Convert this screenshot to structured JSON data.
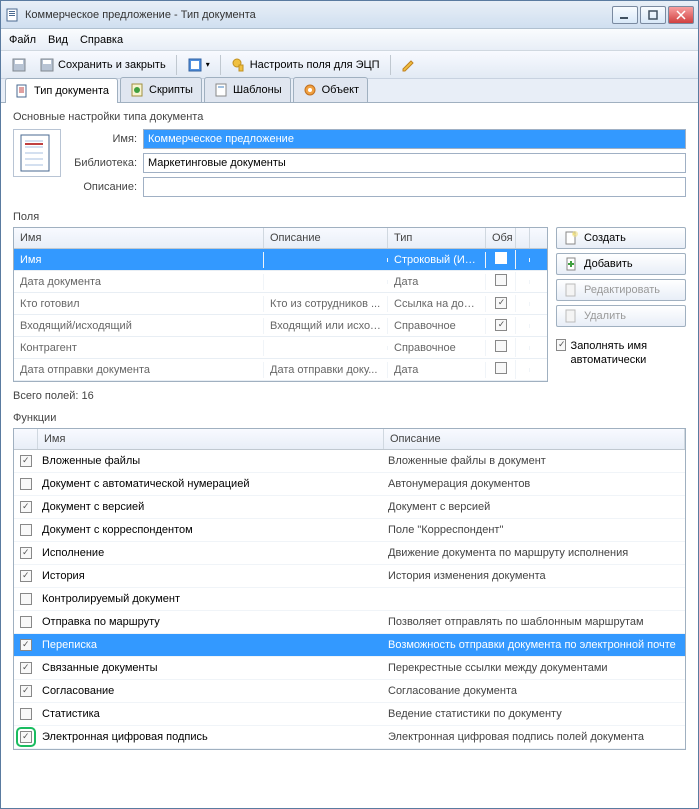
{
  "window": {
    "title": "Коммерческое предложение - Тип документа"
  },
  "menu": {
    "file": "Файл",
    "view": "Вид",
    "help": "Справка"
  },
  "toolbar": {
    "save_close": "Сохранить и закрыть",
    "configure_eds": "Настроить поля для ЭЦП"
  },
  "tabs": [
    {
      "label": "Тип документа"
    },
    {
      "label": "Скрипты"
    },
    {
      "label": "Шаблоны"
    },
    {
      "label": "Объект"
    }
  ],
  "section": "Основные настройки типа документа",
  "form": {
    "name_label": "Имя:",
    "name_value": "Коммерческое предложение",
    "library_label": "Библиотека:",
    "library_value": "Маркетинговые документы",
    "desc_label": "Описание:",
    "desc_value": ""
  },
  "fields_label": "Поля",
  "fields_head": {
    "name": "Имя",
    "desc": "Описание",
    "type": "Тип",
    "req": "Обя"
  },
  "fields": [
    {
      "name": "Имя",
      "desc": "",
      "type": "Строковый (Инд...",
      "req": false,
      "selected": true
    },
    {
      "name": "Дата документа",
      "desc": "",
      "type": "Дата",
      "req": false
    },
    {
      "name": "Кто готовил",
      "desc": "Кто из сотрудников ...",
      "type": "Ссылка на доку...",
      "req": true
    },
    {
      "name": "Входящий/исходящий",
      "desc": "Входящий или исход...",
      "type": "Справочное",
      "req": true
    },
    {
      "name": "Контрагент",
      "desc": "",
      "type": "Справочное",
      "req": false
    },
    {
      "name": "Дата отправки документа",
      "desc": "Дата отправки доку...",
      "type": "Дата",
      "req": false
    }
  ],
  "side": {
    "create": "Создать",
    "add": "Добавить",
    "edit": "Редактировать",
    "delete": "Удалить",
    "autofill": "Заполнять имя автоматически"
  },
  "total": "Всего полей: 16",
  "funcs_label": "Функции",
  "funcs_head": {
    "name": "Имя",
    "desc": "Описание"
  },
  "funcs": [
    {
      "on": true,
      "name": "Вложенные файлы",
      "desc": "Вложенные файлы в документ"
    },
    {
      "on": false,
      "name": "Документ с автоматической нумерацией",
      "desc": "Автонумерация документов"
    },
    {
      "on": true,
      "name": "Документ с версией",
      "desc": "Документ с версией"
    },
    {
      "on": false,
      "name": "Документ с корреспондентом",
      "desc": "Поле \"Корреспондент\""
    },
    {
      "on": true,
      "name": "Исполнение",
      "desc": "Движение документа по маршруту исполнения"
    },
    {
      "on": true,
      "name": "История",
      "desc": "История изменения документа"
    },
    {
      "on": false,
      "name": "Контролируемый документ",
      "desc": ""
    },
    {
      "on": false,
      "name": "Отправка по маршруту",
      "desc": "Позволяет отправлять по шаблонным маршрутам"
    },
    {
      "on": true,
      "name": "Переписка",
      "desc": "Возможность отправки документа по электронной почте",
      "selected": true
    },
    {
      "on": true,
      "name": "Связанные документы",
      "desc": "Перекрестные ссылки между документами"
    },
    {
      "on": true,
      "name": "Согласование",
      "desc": "Согласование документа"
    },
    {
      "on": false,
      "name": "Статистика",
      "desc": "Ведение статистики по документу"
    },
    {
      "on": true,
      "name": "Электронная цифровая подпись",
      "desc": "Электронная цифровая подпись полей документа",
      "highlight": true
    }
  ]
}
